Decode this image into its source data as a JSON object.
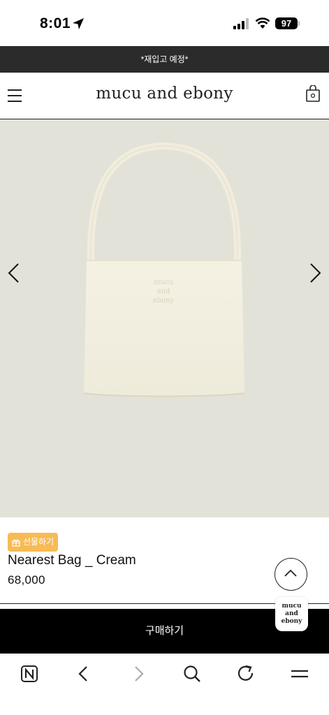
{
  "status_bar": {
    "time": "8:01",
    "battery": "97"
  },
  "announcement": {
    "text": "*재입고 예정*"
  },
  "header": {
    "brand": "mucu and ebony"
  },
  "product": {
    "image_logo_line1": "mucu",
    "image_logo_line2": "and",
    "image_logo_line3": "ebony",
    "gift_label": "선물하기",
    "name": "Nearest Bag _ Cream",
    "price": "68,000"
  },
  "actions": {
    "buy_label": "구매하기",
    "bubble_line1": "mucu",
    "bubble_line2": "and",
    "bubble_line3": "ebony"
  },
  "colors": {
    "announcement_bg": "#2b2b2b",
    "hero_bg": "#e3e2d9",
    "gift_badge": "#f7bb55",
    "buy_bar": "#000000"
  },
  "icons": [
    "location-arrow-icon",
    "signal-icon",
    "wifi-icon",
    "menu-icon",
    "shopping-bag-icon",
    "chevron-left-icon",
    "chevron-right-icon",
    "gift-icon",
    "chevron-up-icon",
    "naver-icon",
    "back-icon",
    "forward-icon",
    "search-icon",
    "reload-icon",
    "browser-menu-icon"
  ]
}
